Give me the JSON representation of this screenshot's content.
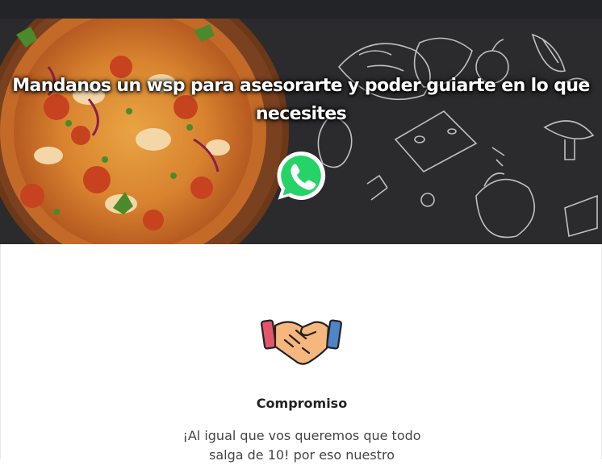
{
  "hero": {
    "title": "Mandanos un wsp para asesorarte y poder guiarte en lo que necesites",
    "whatsapp_icon": "whatsapp-icon",
    "whatsapp_color": "#25D366"
  },
  "feature": {
    "icon": "handshake-icon",
    "title": "Compromiso",
    "text": "¡Al igual que vos queremos que todo salga de 10! por eso nuestro"
  },
  "colors": {
    "topbar": "#232427",
    "hero_bg": "#2b2b2d"
  }
}
